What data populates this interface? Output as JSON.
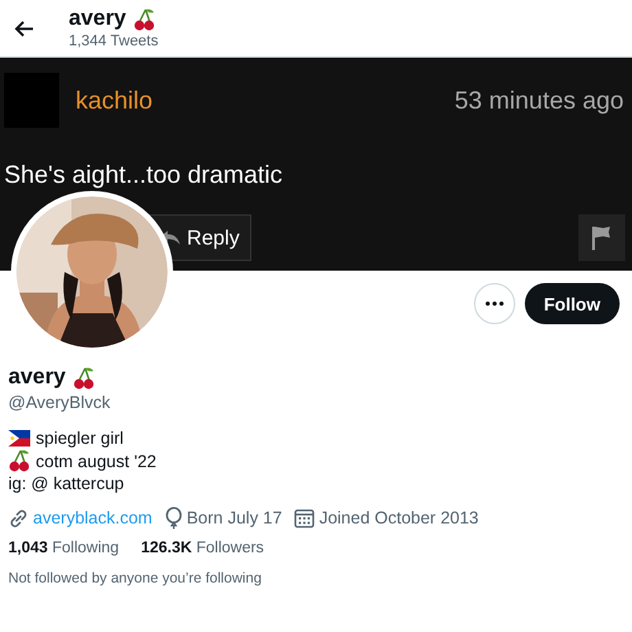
{
  "header": {
    "name": "avery",
    "tweet_count": "1,344 Tweets"
  },
  "banner": {
    "username": "kachilo",
    "time": "53 minutes ago",
    "comment": "She's aight...too dramatic",
    "reply_label": "Reply"
  },
  "follow_label": "Follow",
  "profile": {
    "name": "avery",
    "handle": "@AveryBlvck",
    "bio": [
      {
        "kind": "flag",
        "text": "spiegler girl"
      },
      {
        "kind": "cherry",
        "text": "cotm august '22"
      },
      {
        "kind": "plain",
        "text": "ig: @ kattercup"
      }
    ],
    "meta": [
      {
        "kind": "link",
        "text": "averyblack.com"
      },
      {
        "kind": "birthday",
        "text": "Born July 17"
      },
      {
        "kind": "joined",
        "text": "Joined October 2013"
      }
    ],
    "stats": [
      {
        "text": "**1,043** Following"
      },
      {
        "text": "**126.3K** Followers"
      }
    ],
    "note": "Not followed by anyone you’re following"
  }
}
